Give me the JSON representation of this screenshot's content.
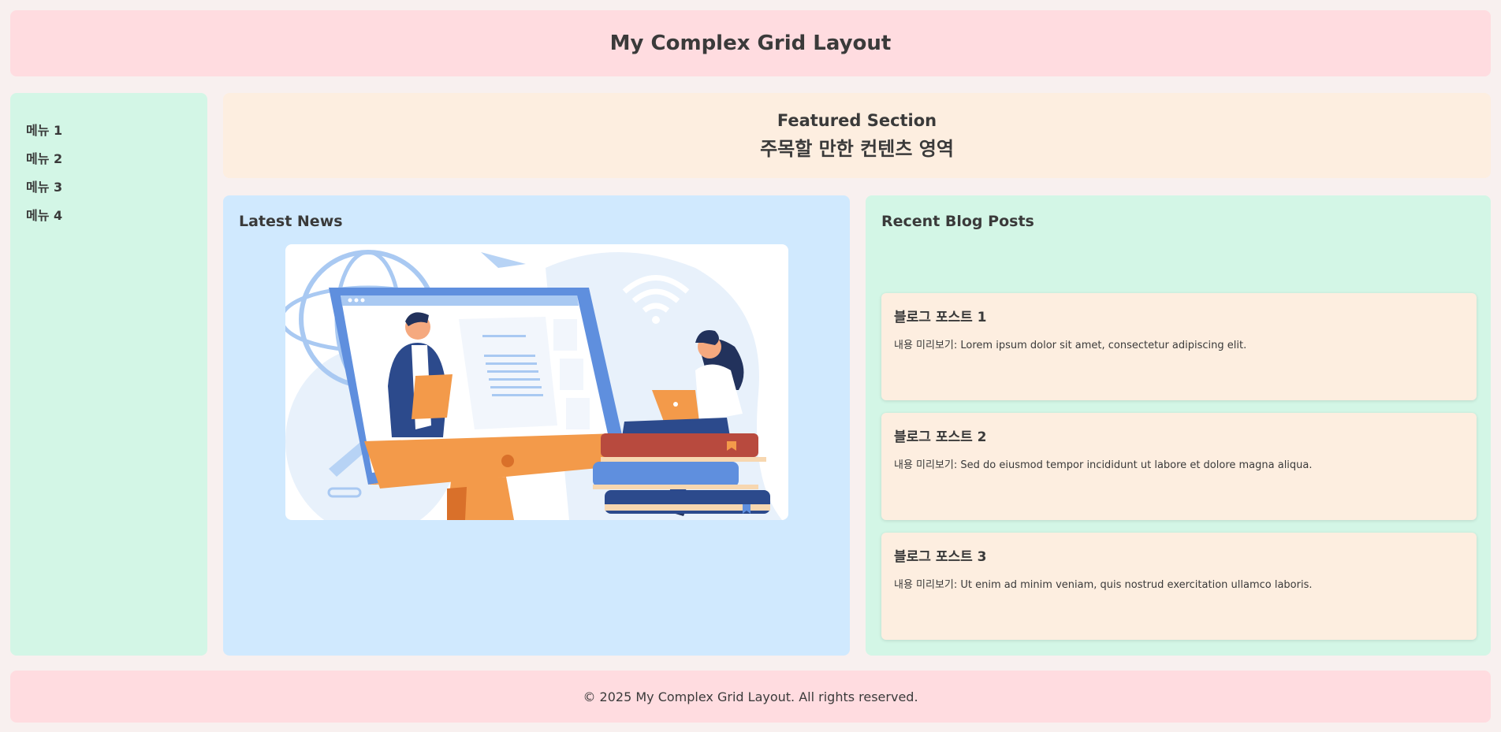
{
  "header": {
    "title": "My Complex Grid Layout"
  },
  "sidebar": {
    "items": [
      {
        "label": "메뉴 1"
      },
      {
        "label": "메뉴 2"
      },
      {
        "label": "메뉴 3"
      },
      {
        "label": "메뉴 4"
      }
    ]
  },
  "featured": {
    "title": "Featured Section",
    "subtitle": "주목할 만한 컨텐츠 영역"
  },
  "news": {
    "title": "Latest News",
    "image": "illustration-online-meeting"
  },
  "blog": {
    "title": "Recent Blog Posts",
    "posts": [
      {
        "title": "블로그 포스트 1",
        "preview": "내용 미리보기: Lorem ipsum dolor sit amet, consectetur adipiscing elit."
      },
      {
        "title": "블로그 포스트 2",
        "preview": "내용 미리보기: Sed do eiusmod tempor incididunt ut labore et dolore magna aliqua."
      },
      {
        "title": "블로그 포스트 3",
        "preview": "내용 미리보기: Ut enim ad minim veniam, quis nostrud exercitation ullamco laboris."
      }
    ]
  },
  "footer": {
    "text": "© 2025 My Complex Grid Layout. All rights reserved."
  },
  "colors": {
    "background": "#f8f0ef",
    "header": "#ffdce0",
    "sidebar": "#d3f6e6",
    "featured": "#fdeee0",
    "news": "#d0e9fe",
    "blog": "#d3f6e6",
    "card": "#fdeee0"
  }
}
